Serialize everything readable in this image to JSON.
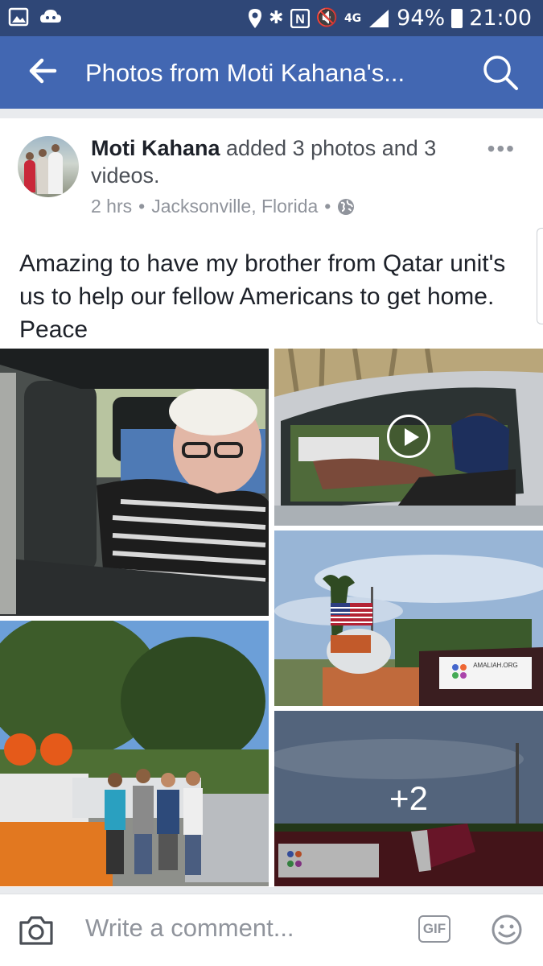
{
  "status_bar": {
    "battery_percent": "94%",
    "time": "21:00",
    "network": "4G"
  },
  "app_bar": {
    "title": "Photos from Moti Kahana's..."
  },
  "post": {
    "author": "Moti Kahana",
    "action_text": "added 3 photos and 3 videos.",
    "time": "2 hrs",
    "location": "Jacksonville, Florida",
    "separator": "•",
    "body": "Amazing to have my brother from Qatar unit's us to help our fellow Americans to get home. Peace",
    "more_label": "•••"
  },
  "media": {
    "extra_count": "+2"
  },
  "comment_bar": {
    "placeholder": "Write a comment...",
    "gif_label": "GIF"
  },
  "colors": {
    "facebook_blue": "#4267b2",
    "status_bar": "#2f4777"
  }
}
